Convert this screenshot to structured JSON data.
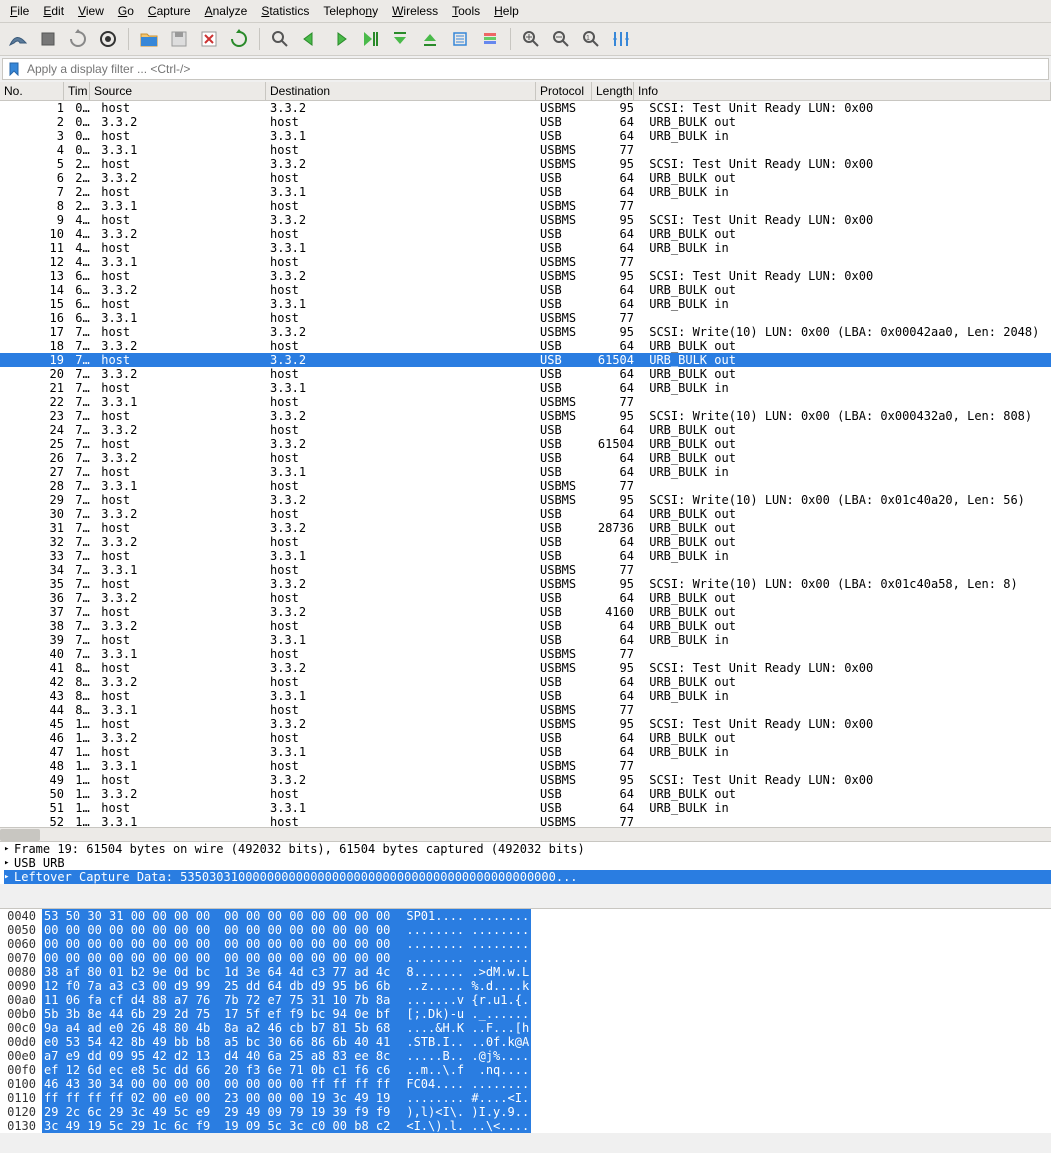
{
  "menu": [
    "File",
    "Edit",
    "View",
    "Go",
    "Capture",
    "Analyze",
    "Statistics",
    "Telephony",
    "Wireless",
    "Tools",
    "Help"
  ],
  "menu_underline_idx": [
    0,
    0,
    0,
    0,
    0,
    0,
    0,
    7,
    0,
    0,
    0
  ],
  "filter_placeholder": "Apply a display filter ... <Ctrl-/>",
  "columns": [
    "No.",
    "Tim",
    "Source",
    "Destination",
    "Protocol",
    "Length",
    "Info"
  ],
  "selected_row": 18,
  "packets": [
    {
      "no": 1,
      "tim": "0…",
      "src": "host",
      "dst": "3.3.2",
      "proto": "USBMS",
      "len": 95,
      "info": "SCSI: Test Unit Ready LUN: 0x00"
    },
    {
      "no": 2,
      "tim": "0…",
      "src": "3.3.2",
      "dst": "host",
      "proto": "USB",
      "len": 64,
      "info": "URB_BULK out"
    },
    {
      "no": 3,
      "tim": "0…",
      "src": "host",
      "dst": "3.3.1",
      "proto": "USB",
      "len": 64,
      "info": "URB_BULK in"
    },
    {
      "no": 4,
      "tim": "0…",
      "src": "3.3.1",
      "dst": "host",
      "proto": "USBMS",
      "len": 77,
      "info": ""
    },
    {
      "no": 5,
      "tim": "2…",
      "src": "host",
      "dst": "3.3.2",
      "proto": "USBMS",
      "len": 95,
      "info": "SCSI: Test Unit Ready LUN: 0x00"
    },
    {
      "no": 6,
      "tim": "2…",
      "src": "3.3.2",
      "dst": "host",
      "proto": "USB",
      "len": 64,
      "info": "URB_BULK out"
    },
    {
      "no": 7,
      "tim": "2…",
      "src": "host",
      "dst": "3.3.1",
      "proto": "USB",
      "len": 64,
      "info": "URB_BULK in"
    },
    {
      "no": 8,
      "tim": "2…",
      "src": "3.3.1",
      "dst": "host",
      "proto": "USBMS",
      "len": 77,
      "info": ""
    },
    {
      "no": 9,
      "tim": "4…",
      "src": "host",
      "dst": "3.3.2",
      "proto": "USBMS",
      "len": 95,
      "info": "SCSI: Test Unit Ready LUN: 0x00"
    },
    {
      "no": 10,
      "tim": "4…",
      "src": "3.3.2",
      "dst": "host",
      "proto": "USB",
      "len": 64,
      "info": "URB_BULK out"
    },
    {
      "no": 11,
      "tim": "4…",
      "src": "host",
      "dst": "3.3.1",
      "proto": "USB",
      "len": 64,
      "info": "URB_BULK in"
    },
    {
      "no": 12,
      "tim": "4…",
      "src": "3.3.1",
      "dst": "host",
      "proto": "USBMS",
      "len": 77,
      "info": ""
    },
    {
      "no": 13,
      "tim": "6…",
      "src": "host",
      "dst": "3.3.2",
      "proto": "USBMS",
      "len": 95,
      "info": "SCSI: Test Unit Ready LUN: 0x00"
    },
    {
      "no": 14,
      "tim": "6…",
      "src": "3.3.2",
      "dst": "host",
      "proto": "USB",
      "len": 64,
      "info": "URB_BULK out"
    },
    {
      "no": 15,
      "tim": "6…",
      "src": "host",
      "dst": "3.3.1",
      "proto": "USB",
      "len": 64,
      "info": "URB_BULK in"
    },
    {
      "no": 16,
      "tim": "6…",
      "src": "3.3.1",
      "dst": "host",
      "proto": "USBMS",
      "len": 77,
      "info": ""
    },
    {
      "no": 17,
      "tim": "7…",
      "src": "host",
      "dst": "3.3.2",
      "proto": "USBMS",
      "len": 95,
      "info": "SCSI: Write(10) LUN: 0x00 (LBA: 0x00042aa0, Len: 2048)"
    },
    {
      "no": 18,
      "tim": "7…",
      "src": "3.3.2",
      "dst": "host",
      "proto": "USB",
      "len": 64,
      "info": "URB_BULK out"
    },
    {
      "no": 19,
      "tim": "7…",
      "src": "host",
      "dst": "3.3.2",
      "proto": "USB",
      "len": 61504,
      "info": "URB_BULK out"
    },
    {
      "no": 20,
      "tim": "7…",
      "src": "3.3.2",
      "dst": "host",
      "proto": "USB",
      "len": 64,
      "info": "URB_BULK out"
    },
    {
      "no": 21,
      "tim": "7…",
      "src": "host",
      "dst": "3.3.1",
      "proto": "USB",
      "len": 64,
      "info": "URB_BULK in"
    },
    {
      "no": 22,
      "tim": "7…",
      "src": "3.3.1",
      "dst": "host",
      "proto": "USBMS",
      "len": 77,
      "info": ""
    },
    {
      "no": 23,
      "tim": "7…",
      "src": "host",
      "dst": "3.3.2",
      "proto": "USBMS",
      "len": 95,
      "info": "SCSI: Write(10) LUN: 0x00 (LBA: 0x000432a0, Len: 808)"
    },
    {
      "no": 24,
      "tim": "7…",
      "src": "3.3.2",
      "dst": "host",
      "proto": "USB",
      "len": 64,
      "info": "URB_BULK out"
    },
    {
      "no": 25,
      "tim": "7…",
      "src": "host",
      "dst": "3.3.2",
      "proto": "USB",
      "len": 61504,
      "info": "URB_BULK out"
    },
    {
      "no": 26,
      "tim": "7…",
      "src": "3.3.2",
      "dst": "host",
      "proto": "USB",
      "len": 64,
      "info": "URB_BULK out"
    },
    {
      "no": 27,
      "tim": "7…",
      "src": "host",
      "dst": "3.3.1",
      "proto": "USB",
      "len": 64,
      "info": "URB_BULK in"
    },
    {
      "no": 28,
      "tim": "7…",
      "src": "3.3.1",
      "dst": "host",
      "proto": "USBMS",
      "len": 77,
      "info": ""
    },
    {
      "no": 29,
      "tim": "7…",
      "src": "host",
      "dst": "3.3.2",
      "proto": "USBMS",
      "len": 95,
      "info": "SCSI: Write(10) LUN: 0x00 (LBA: 0x01c40a20, Len: 56)"
    },
    {
      "no": 30,
      "tim": "7…",
      "src": "3.3.2",
      "dst": "host",
      "proto": "USB",
      "len": 64,
      "info": "URB_BULK out"
    },
    {
      "no": 31,
      "tim": "7…",
      "src": "host",
      "dst": "3.3.2",
      "proto": "USB",
      "len": 28736,
      "info": "URB_BULK out"
    },
    {
      "no": 32,
      "tim": "7…",
      "src": "3.3.2",
      "dst": "host",
      "proto": "USB",
      "len": 64,
      "info": "URB_BULK out"
    },
    {
      "no": 33,
      "tim": "7…",
      "src": "host",
      "dst": "3.3.1",
      "proto": "USB",
      "len": 64,
      "info": "URB_BULK in"
    },
    {
      "no": 34,
      "tim": "7…",
      "src": "3.3.1",
      "dst": "host",
      "proto": "USBMS",
      "len": 77,
      "info": ""
    },
    {
      "no": 35,
      "tim": "7…",
      "src": "host",
      "dst": "3.3.2",
      "proto": "USBMS",
      "len": 95,
      "info": "SCSI: Write(10) LUN: 0x00 (LBA: 0x01c40a58, Len: 8)"
    },
    {
      "no": 36,
      "tim": "7…",
      "src": "3.3.2",
      "dst": "host",
      "proto": "USB",
      "len": 64,
      "info": "URB_BULK out"
    },
    {
      "no": 37,
      "tim": "7…",
      "src": "host",
      "dst": "3.3.2",
      "proto": "USB",
      "len": 4160,
      "info": "URB_BULK out"
    },
    {
      "no": 38,
      "tim": "7…",
      "src": "3.3.2",
      "dst": "host",
      "proto": "USB",
      "len": 64,
      "info": "URB_BULK out"
    },
    {
      "no": 39,
      "tim": "7…",
      "src": "host",
      "dst": "3.3.1",
      "proto": "USB",
      "len": 64,
      "info": "URB_BULK in"
    },
    {
      "no": 40,
      "tim": "7…",
      "src": "3.3.1",
      "dst": "host",
      "proto": "USBMS",
      "len": 77,
      "info": ""
    },
    {
      "no": 41,
      "tim": "8…",
      "src": "host",
      "dst": "3.3.2",
      "proto": "USBMS",
      "len": 95,
      "info": "SCSI: Test Unit Ready LUN: 0x00"
    },
    {
      "no": 42,
      "tim": "8…",
      "src": "3.3.2",
      "dst": "host",
      "proto": "USB",
      "len": 64,
      "info": "URB_BULK out"
    },
    {
      "no": 43,
      "tim": "8…",
      "src": "host",
      "dst": "3.3.1",
      "proto": "USB",
      "len": 64,
      "info": "URB_BULK in"
    },
    {
      "no": 44,
      "tim": "8…",
      "src": "3.3.1",
      "dst": "host",
      "proto": "USBMS",
      "len": 77,
      "info": ""
    },
    {
      "no": 45,
      "tim": "1…",
      "src": "host",
      "dst": "3.3.2",
      "proto": "USBMS",
      "len": 95,
      "info": "SCSI: Test Unit Ready LUN: 0x00"
    },
    {
      "no": 46,
      "tim": "1…",
      "src": "3.3.2",
      "dst": "host",
      "proto": "USB",
      "len": 64,
      "info": "URB_BULK out"
    },
    {
      "no": 47,
      "tim": "1…",
      "src": "host",
      "dst": "3.3.1",
      "proto": "USB",
      "len": 64,
      "info": "URB_BULK in"
    },
    {
      "no": 48,
      "tim": "1…",
      "src": "3.3.1",
      "dst": "host",
      "proto": "USBMS",
      "len": 77,
      "info": ""
    },
    {
      "no": 49,
      "tim": "1…",
      "src": "host",
      "dst": "3.3.2",
      "proto": "USBMS",
      "len": 95,
      "info": "SCSI: Test Unit Ready LUN: 0x00"
    },
    {
      "no": 50,
      "tim": "1…",
      "src": "3.3.2",
      "dst": "host",
      "proto": "USB",
      "len": 64,
      "info": "URB_BULK out"
    },
    {
      "no": 51,
      "tim": "1…",
      "src": "host",
      "dst": "3.3.1",
      "proto": "USB",
      "len": 64,
      "info": "URB_BULK in"
    },
    {
      "no": 52,
      "tim": "1…",
      "src": "3.3.1",
      "dst": "host",
      "proto": "USBMS",
      "len": 77,
      "info": ""
    }
  ],
  "tree": [
    {
      "label": "Frame 19: 61504 bytes on wire (492032 bits), 61504 bytes captured (492032 bits)",
      "sel": false
    },
    {
      "label": "USB URB",
      "sel": false
    },
    {
      "label": "Leftover Capture Data: 5350303100000000000000000000000000000000000000000000...",
      "sel": true
    }
  ],
  "hex": [
    {
      "off": "0040",
      "b1": "53 50 30 31 00 00 00 00",
      "b2": "00 00 00 00 00 00 00 00",
      "a": "SP01.... ........"
    },
    {
      "off": "0050",
      "b1": "00 00 00 00 00 00 00 00",
      "b2": "00 00 00 00 00 00 00 00",
      "a": "........ ........"
    },
    {
      "off": "0060",
      "b1": "00 00 00 00 00 00 00 00",
      "b2": "00 00 00 00 00 00 00 00",
      "a": "........ ........"
    },
    {
      "off": "0070",
      "b1": "00 00 00 00 00 00 00 00",
      "b2": "00 00 00 00 00 00 00 00",
      "a": "........ ........"
    },
    {
      "off": "0080",
      "b1": "38 af 80 01 b2 9e 0d bc",
      "b2": "1d 3e 64 4d c3 77 ad 4c",
      "a": "8....... .>dM.w.L"
    },
    {
      "off": "0090",
      "b1": "12 f0 7a a3 c3 00 d9 99",
      "b2": "25 dd 64 db d9 95 b6 6b",
      "a": "..z..... %.d....k"
    },
    {
      "off": "00a0",
      "b1": "11 06 fa cf d4 88 a7 76",
      "b2": "7b 72 e7 75 31 10 7b 8a",
      "a": ".......v {r.u1.{."
    },
    {
      "off": "00b0",
      "b1": "5b 3b 8e 44 6b 29 2d 75",
      "b2": "17 5f ef f9 bc 94 0e bf",
      "a": "[;.Dk)-u ._......"
    },
    {
      "off": "00c0",
      "b1": "9a a4 ad e0 26 48 80 4b",
      "b2": "8a a2 46 cb b7 81 5b 68",
      "a": "....&H.K ..F...[h"
    },
    {
      "off": "00d0",
      "b1": "e0 53 54 42 8b 49 bb b8",
      "b2": "a5 bc 30 66 86 6b 40 41",
      "a": ".STB.I.. ..0f.k@A"
    },
    {
      "off": "00e0",
      "b1": "a7 e9 dd 09 95 42 d2 13",
      "b2": "d4 40 6a 25 a8 83 ee 8c",
      "a": ".....B.. .@j%...."
    },
    {
      "off": "00f0",
      "b1": "ef 12 6d ec e8 5c dd 66",
      "b2": "20 f3 6e 71 0b c1 f6 c6",
      "a": "..m..\\.f  .nq...."
    },
    {
      "off": "0100",
      "b1": "46 43 30 34 00 00 00 00",
      "b2": "00 00 00 00 ff ff ff ff",
      "a": "FC04.... ........"
    },
    {
      "off": "0110",
      "b1": "ff ff ff ff 02 00 e0 00",
      "b2": "23 00 00 00 19 3c 49 19",
      "a": "........ #....<I."
    },
    {
      "off": "0120",
      "b1": "29 2c 6c 29 3c 49 5c e9",
      "b2": "29 49 09 79 19 39 f9 f9",
      "a": "),l)<I\\. )I.y.9.."
    },
    {
      "off": "0130",
      "b1": "3c 49 19 5c 29 1c 6c f9",
      "b2": "19 09 5c 3c c0 00 b8 c2",
      "a": "<I.\\).l. ..\\<...."
    }
  ]
}
